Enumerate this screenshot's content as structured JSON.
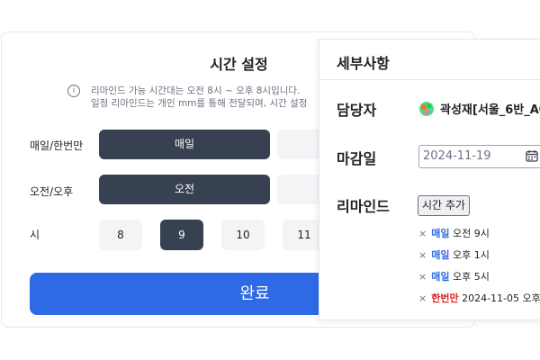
{
  "dialog": {
    "title": "시간 설정",
    "info_line1": "리마인드 가능 시간대는 오전 8시 ~ 오후 8시입니다.",
    "info_line2": "일정 리마인드는 개인 mm를 통해 전달되며, 시간 설정",
    "repeat_label": "매일/한번만",
    "repeat_options": [
      "매일",
      ""
    ],
    "ampm_label": "오전/오후",
    "ampm_options": [
      "오전",
      ""
    ],
    "hour_label": "시",
    "hours": [
      "8",
      "9",
      "10",
      "11"
    ],
    "selected_hour": "9",
    "done_label": "완료",
    "colors": {
      "primary": "#2f6ae6",
      "selected": "#374151"
    }
  },
  "panel": {
    "title": "세부사항",
    "assignee_label": "담당자",
    "assignee_name": "곽성재[서울_6반_A0",
    "due_label": "마감일",
    "due_value": "2024-11-19",
    "reminder_label": "리마인드",
    "add_time_label": "시간 추가",
    "reminders": [
      {
        "type": "매일",
        "time": "오전 9시"
      },
      {
        "type": "매일",
        "time": "오후 1시"
      },
      {
        "type": "매일",
        "time": "오후 5시"
      },
      {
        "type": "한번만",
        "time": "2024-11-05 오후"
      }
    ],
    "colors": {
      "daily": "#2f6ae6",
      "once": "#dc2626"
    }
  }
}
